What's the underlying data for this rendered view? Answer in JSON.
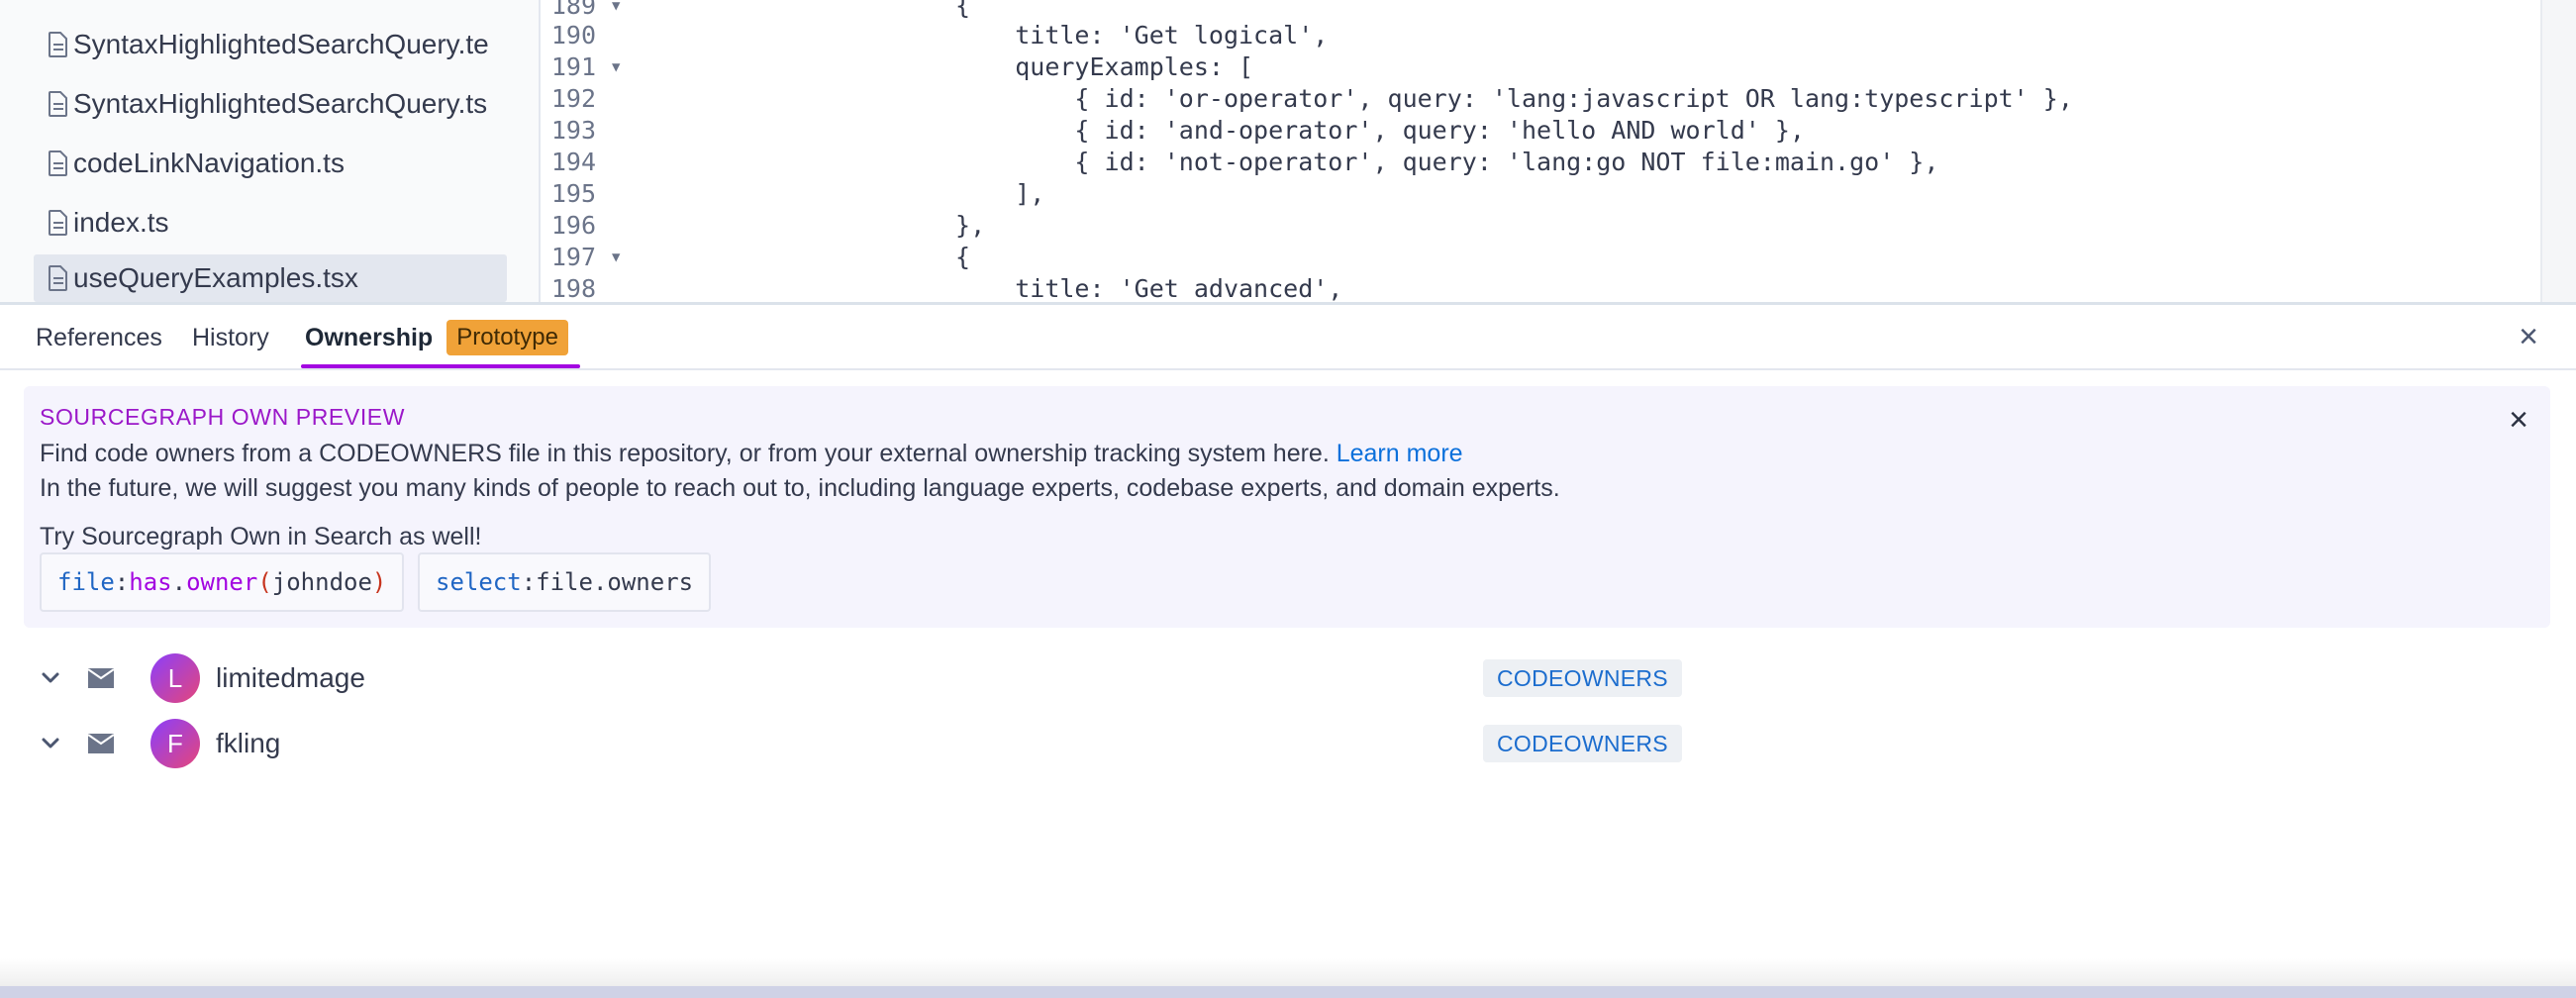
{
  "sidebar": {
    "files": [
      {
        "name": "SyntaxHighlightedSearchQuery.te",
        "selected": false
      },
      {
        "name": "SyntaxHighlightedSearchQuery.ts",
        "selected": false
      },
      {
        "name": "codeLinkNavigation.ts",
        "selected": false
      },
      {
        "name": "index.ts",
        "selected": false
      },
      {
        "name": "useQueryExamples.tsx",
        "selected": true
      }
    ]
  },
  "code": {
    "lines": [
      {
        "no": "189",
        "fold": true,
        "text": "                    {"
      },
      {
        "no": "190",
        "fold": false,
        "text": "                        title: 'Get logical',"
      },
      {
        "no": "191",
        "fold": true,
        "text": "                        queryExamples: ["
      },
      {
        "no": "192",
        "fold": false,
        "text": "                            { id: 'or-operator', query: 'lang:javascript OR lang:typescript' },"
      },
      {
        "no": "193",
        "fold": false,
        "text": "                            { id: 'and-operator', query: 'hello AND world' },"
      },
      {
        "no": "194",
        "fold": false,
        "text": "                            { id: 'not-operator', query: 'lang:go NOT file:main.go' },"
      },
      {
        "no": "195",
        "fold": false,
        "text": "                        ],"
      },
      {
        "no": "196",
        "fold": false,
        "text": "                    },"
      },
      {
        "no": "197",
        "fold": true,
        "text": "                    {"
      },
      {
        "no": "198",
        "fold": false,
        "text": "                        title: 'Get advanced',"
      }
    ]
  },
  "panel": {
    "tabs": {
      "references": "References",
      "history": "History",
      "ownership": "Ownership",
      "prototype_badge": "Prototype"
    },
    "close_icon": "×"
  },
  "preview": {
    "title": "SOURCEGRAPH OWN PREVIEW",
    "line1": "Find code owners from a CODEOWNERS file in this repository, or from your external ownership tracking system here. ",
    "learn_more": "Learn more",
    "line2": "In the future, we will suggest you many kinds of people to reach out to, including language experts, codebase experts, and domain experts.",
    "line3": "Try Sourcegraph Own in Search as well!",
    "close_icon": "×",
    "query1": {
      "field": "file",
      "sep": ":",
      "pred1": "has",
      "dot": ".",
      "pred2": "owner",
      "open": "(",
      "value": "johndoe",
      "close": ")"
    },
    "query2": {
      "field": "select",
      "sep": ":",
      "value": "file.owners"
    }
  },
  "owners": [
    {
      "initial": "L",
      "name": "limitedmage",
      "source": "CODEOWNERS"
    },
    {
      "initial": "F",
      "name": "fkling",
      "source": "CODEOWNERS"
    }
  ],
  "colors": {
    "accent": "#a305e1",
    "badge": "#f0a238",
    "link": "#0b70db"
  }
}
